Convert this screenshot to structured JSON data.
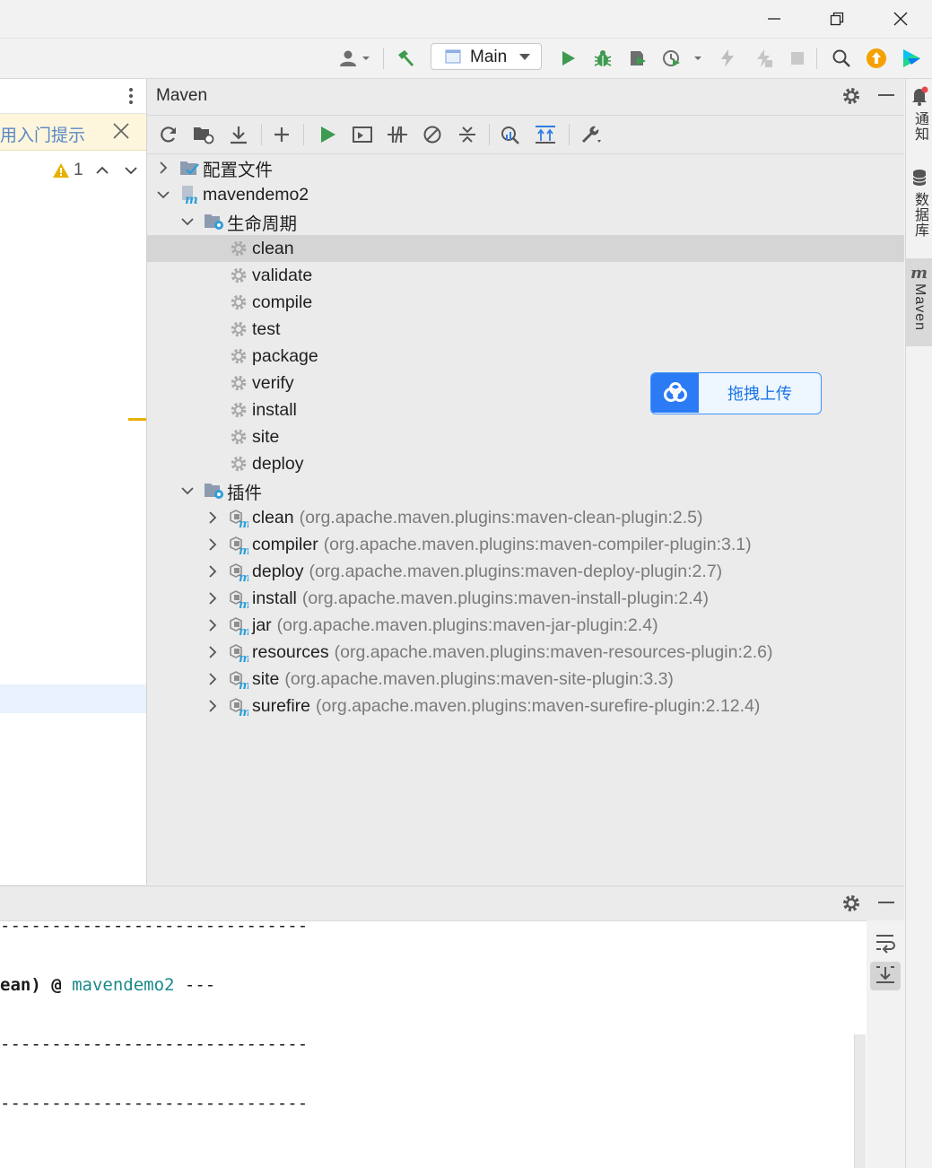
{
  "window": {
    "minimize_label": "minimize-window",
    "restore_label": "restore-window",
    "close_label": "close-window"
  },
  "toolbar": {
    "run_config": "Main",
    "icons": [
      "user-icon",
      "build-hammer-icon",
      "run-icon",
      "debug-icon",
      "coverage-icon",
      "profile-icon",
      "attach-icon",
      "stop-icon",
      "search-icon",
      "update-icon",
      "jetbrains-toolbox-icon"
    ]
  },
  "left_panel": {
    "tip_text": "使用入门提示",
    "warning_count": "1"
  },
  "maven": {
    "title": "Maven",
    "tree": {
      "profiles": "配置文件",
      "project": "mavendemo2",
      "lifecycle": "生命周期",
      "lifecycle_phases": [
        "clean",
        "validate",
        "compile",
        "test",
        "package",
        "verify",
        "install",
        "site",
        "deploy"
      ],
      "selected_phase": "clean",
      "plugins": "插件",
      "plugin_list": [
        {
          "name": "clean",
          "coords": "(org.apache.maven.plugins:maven-clean-plugin:2.5)"
        },
        {
          "name": "compiler",
          "coords": "(org.apache.maven.plugins:maven-compiler-plugin:3.1)"
        },
        {
          "name": "deploy",
          "coords": "(org.apache.maven.plugins:maven-deploy-plugin:2.7)"
        },
        {
          "name": "install",
          "coords": "(org.apache.maven.plugins:maven-install-plugin:2.4)"
        },
        {
          "name": "jar",
          "coords": "(org.apache.maven.plugins:maven-jar-plugin:2.4)"
        },
        {
          "name": "resources",
          "coords": "(org.apache.maven.plugins:maven-resources-plugin:2.6)"
        },
        {
          "name": "site",
          "coords": "(org.apache.maven.plugins:maven-site-plugin:3.3)"
        },
        {
          "name": "surefire",
          "coords": "(org.apache.maven.plugins:maven-surefire-plugin:2.12.4)"
        }
      ]
    }
  },
  "upload_widget": {
    "label": "拖拽上传"
  },
  "right_strip": {
    "notifications": "通知",
    "database": "数据库",
    "maven": "Maven"
  },
  "console": {
    "line1": "------------------------------",
    "line2_prefix": "ean) @ ",
    "line2_project": "mavendemo2",
    "line2_suffix": " ---",
    "line3": "------------------------------",
    "line4": "------------------------------"
  },
  "colors": {
    "run_green": "#3d9a50",
    "accent_blue": "#3574f0",
    "console_link": "#1a8a8a",
    "warning_yellow": "#e8b100",
    "upload_blue": "#2b7bf5"
  }
}
